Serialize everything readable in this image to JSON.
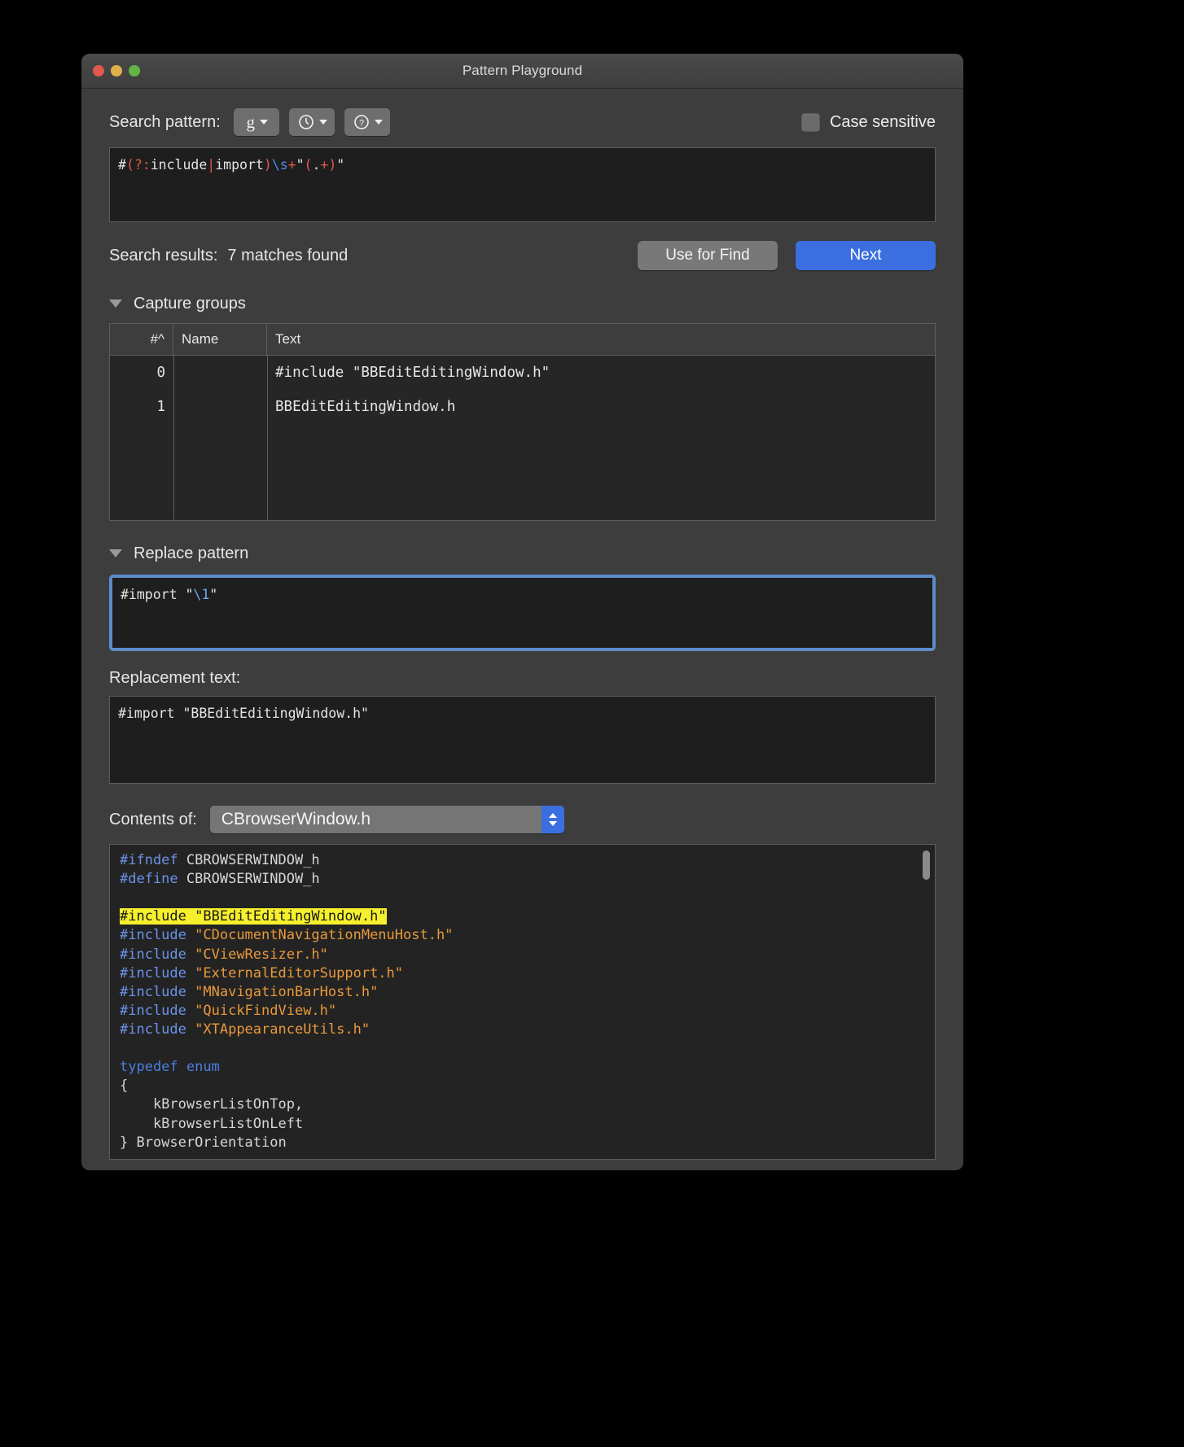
{
  "window": {
    "title": "Pattern Playground",
    "traffic_lights": [
      "close-button",
      "minimize-button",
      "zoom-button"
    ]
  },
  "search": {
    "label": "Search pattern:",
    "buttons": [
      {
        "name": "grep-options-button",
        "glyph": "g"
      },
      {
        "name": "recent-patterns-button",
        "glyph": "clock-icon"
      },
      {
        "name": "pattern-help-button",
        "glyph": "question-icon"
      }
    ],
    "case_sensitive_label": "Case sensitive",
    "case_sensitive_checked": false,
    "pattern_tokens": [
      {
        "t": "#",
        "c": "plain"
      },
      {
        "t": "(?:",
        "c": "meta"
      },
      {
        "t": "include",
        "c": "plain"
      },
      {
        "t": "|",
        "c": "meta"
      },
      {
        "t": "import",
        "c": "plain"
      },
      {
        "t": ")",
        "c": "meta"
      },
      {
        "t": "\\s",
        "c": "class"
      },
      {
        "t": "+",
        "c": "meta"
      },
      {
        "t": "\"",
        "c": "plain"
      },
      {
        "t": "(",
        "c": "meta"
      },
      {
        "t": ".",
        "c": "plain"
      },
      {
        "t": "+",
        "c": "meta"
      },
      {
        "t": ")",
        "c": "meta"
      },
      {
        "t": "\"",
        "c": "plain"
      }
    ],
    "pattern_plain": "#(?:include|import)\\s+\"(.+)\""
  },
  "results": {
    "label": "Search results:",
    "value": "7 matches found",
    "use_for_find_label": "Use for Find",
    "next_label": "Next"
  },
  "capture_groups": {
    "section_label": "Capture groups",
    "expanded": true,
    "columns": [
      "#^",
      "Name",
      "Text"
    ],
    "rows": [
      {
        "num": "0",
        "name": "",
        "text": "#include \"BBEditEditingWindow.h\""
      },
      {
        "num": "1",
        "name": "",
        "text": "BBEditEditingWindow.h"
      }
    ]
  },
  "replace": {
    "section_label": "Replace pattern",
    "expanded": true,
    "pattern_tokens": [
      {
        "t": "#import ",
        "c": "plain"
      },
      {
        "t": "\"",
        "c": "plain"
      },
      {
        "t": "\\1",
        "c": "ref"
      },
      {
        "t": "\"",
        "c": "plain"
      }
    ],
    "pattern_plain": "#import \"\\1\""
  },
  "replacement": {
    "label": "Replacement text:",
    "value": "#import \"BBEditEditingWindow.h\""
  },
  "contents": {
    "label": "Contents of:",
    "selected_file": "CBrowserWindow.h",
    "code_lines": [
      [
        {
          "t": "#ifndef",
          "c": "pp"
        },
        {
          "t": " CBROWSERWINDOW_h",
          "c": "id"
        }
      ],
      [
        {
          "t": "#define",
          "c": "pp"
        },
        {
          "t": " CBROWSERWINDOW_h",
          "c": "id"
        }
      ],
      [],
      [
        {
          "t": "#include",
          "c": "pp"
        },
        {
          "t": " ",
          "c": "id"
        },
        {
          "t": "\"BBEditEditingWindow.h\"",
          "c": "str"
        }
      ],
      [
        {
          "t": "#include",
          "c": "pp"
        },
        {
          "t": " ",
          "c": "id"
        },
        {
          "t": "\"CDocumentNavigationMenuHost.h\"",
          "c": "str"
        }
      ],
      [
        {
          "t": "#include",
          "c": "pp"
        },
        {
          "t": " ",
          "c": "id"
        },
        {
          "t": "\"CViewResizer.h\"",
          "c": "str"
        }
      ],
      [
        {
          "t": "#include",
          "c": "pp"
        },
        {
          "t": " ",
          "c": "id"
        },
        {
          "t": "\"ExternalEditorSupport.h\"",
          "c": "str"
        }
      ],
      [
        {
          "t": "#include",
          "c": "pp"
        },
        {
          "t": " ",
          "c": "id"
        },
        {
          "t": "\"MNavigationBarHost.h\"",
          "c": "str"
        }
      ],
      [
        {
          "t": "#include",
          "c": "pp"
        },
        {
          "t": " ",
          "c": "id"
        },
        {
          "t": "\"QuickFindView.h\"",
          "c": "str"
        }
      ],
      [
        {
          "t": "#include",
          "c": "pp"
        },
        {
          "t": " ",
          "c": "id"
        },
        {
          "t": "\"XTAppearanceUtils.h\"",
          "c": "str"
        }
      ],
      [],
      [
        {
          "t": "typedef",
          "c": "kw"
        },
        {
          "t": " ",
          "c": "id"
        },
        {
          "t": "enum",
          "c": "kw"
        }
      ],
      [
        {
          "t": "{",
          "c": "id"
        }
      ],
      [
        {
          "t": "    kBrowserListOnTop,",
          "c": "id"
        }
      ],
      [
        {
          "t": "    kBrowserListOnLeft",
          "c": "id"
        }
      ],
      [
        {
          "t": "} BrowserOrientation",
          "c": "id"
        }
      ]
    ],
    "highlighted_line_index": 3
  }
}
